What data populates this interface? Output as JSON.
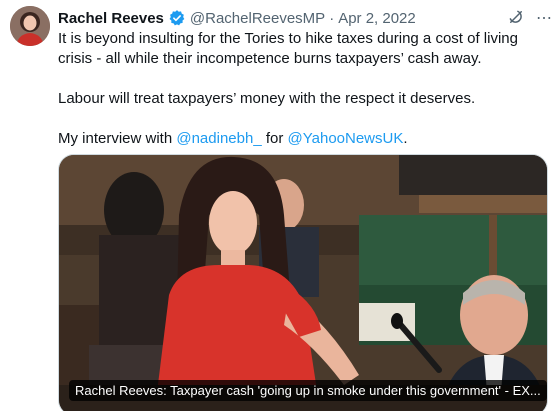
{
  "tweet": {
    "author": {
      "name": "Rachel Reeves",
      "handle": "@RachelReevesMP",
      "separator": "·",
      "date": "Apr 2, 2022"
    },
    "text": {
      "para1": "It is beyond insulting for the Tories to hike taxes during a cost of living crisis - all while their incompetence burns taxpayers’ cash away.",
      "para2": "Labour will treat taxpayers’ money with the respect it deserves.",
      "para3_prefix": "My interview with ",
      "mention1": "@nadinebh_",
      "para3_middle": " for ",
      "mention2": "@YahooNewsUK",
      "para3_suffix": "."
    },
    "media": {
      "caption": "Rachel Reeves: Taxpayer cash 'going up in smoke under this government' - EX..."
    }
  },
  "colors": {
    "link": "#1d9bf0",
    "verified": "#1d9bf0",
    "secondary_text": "#536471",
    "dress_red": "#d8332b"
  },
  "icons": {
    "verified": "verified-badge-icon",
    "grok": "grok-icon",
    "more": "more-icon"
  }
}
